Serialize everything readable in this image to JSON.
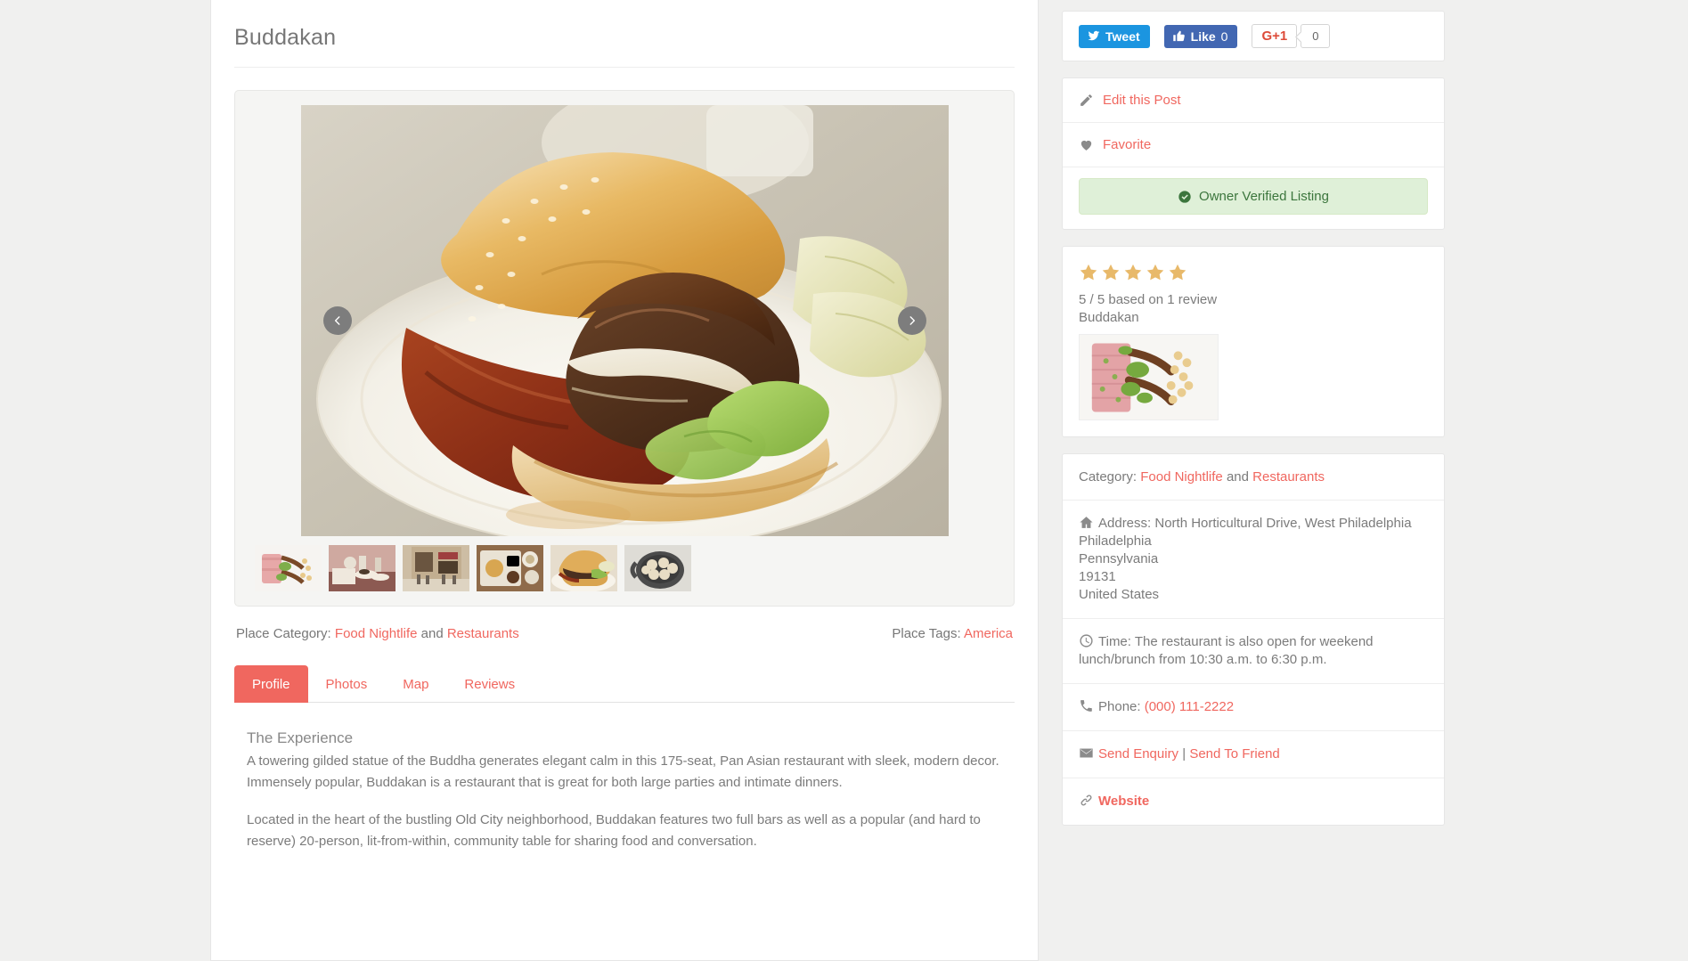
{
  "page": {
    "title": "Buddakan",
    "accent_color": "#f0675f",
    "background_color": "#f0f0ef"
  },
  "social": {
    "tweet_label": "Tweet",
    "like_label": "Like",
    "like_count": "0",
    "gplus_label": "G+1",
    "gplus_count": "0"
  },
  "actions": {
    "edit_label": "Edit this Post",
    "favorite_label": "Favorite",
    "verified_label": "Owner Verified Listing",
    "verified_bg": "#dff0d8",
    "verified_fg": "#3c763d"
  },
  "rating": {
    "stars": 5,
    "star_color": "#e8b96a",
    "summary": "5 / 5 based on 1 review",
    "reviewer_title": "Buddakan"
  },
  "carousel": {
    "prev_icon": "chevron-left-icon",
    "next_icon": "chevron-right-icon",
    "thumb_count": 6,
    "thumbs": [
      "plated-fish-dish",
      "restaurant-table-setting",
      "restaurant-storefront",
      "brunch-spread",
      "burger-closeup",
      "dumplings-in-pot"
    ]
  },
  "meta": {
    "category_label": "Place Category:",
    "category_1": "Food Nightlife",
    "category_joiner": "and",
    "category_2": "Restaurants",
    "tags_label": "Place Tags:",
    "tag_1": "America"
  },
  "tabs": [
    {
      "label": "Profile",
      "active": true
    },
    {
      "label": "Photos",
      "active": false
    },
    {
      "label": "Map",
      "active": false
    },
    {
      "label": "Reviews",
      "active": false
    }
  ],
  "profile": {
    "section_title": "The Experience",
    "paragraph_1": "A towering gilded statue of the Buddha generates elegant calm in this 175-seat, Pan Asian restaurant with sleek, modern decor. Immensely popular, Buddakan is a restaurant that is great for both large parties and intimate dinners.",
    "paragraph_2": "Located in the heart of the bustling Old City neighborhood, Buddakan features two full bars as well as a popular (and hard to reserve) 20-person, lit-from-within, community table for sharing food and conversation."
  },
  "sidebar_info": {
    "category_label": "Category:",
    "category_1": "Food Nightlife",
    "category_joiner": "and",
    "category_2": "Restaurants",
    "address_label": "Address:",
    "address_line_1": "North Horticultural Drive, West Philadelphia",
    "address_line_2": "Philadelphia",
    "address_line_3": "Pennsylvania",
    "address_line_4": "19131",
    "address_line_5": "United States",
    "time_label": "Time:",
    "time_value": "The restaurant is also open for weekend lunch/brunch from 10:30 a.m. to 6:30 p.m.",
    "phone_label": "Phone:",
    "phone_value": "(000) 111-2222",
    "send_enquiry_label": "Send Enquiry",
    "separator": "|",
    "send_friend_label": "Send To Friend",
    "website_label": "Website"
  }
}
